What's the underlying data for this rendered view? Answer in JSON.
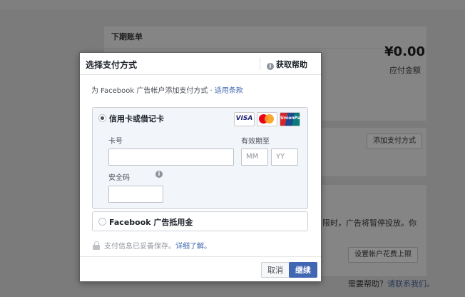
{
  "background": {
    "billing_card_title": "下期账单",
    "amount": "¥0.00",
    "amount_label": "应付金额",
    "add_payment_button": "添加支付方式",
    "warning_text_line1": "限时，广告将暂停投放。你",
    "warning_text_line2": "",
    "set_limit_button": "设置帐户花费上限",
    "help_prefix": "需要帮助？",
    "help_link": "请联系我们。"
  },
  "modal": {
    "title": "选择支付方式",
    "help_label": "获取帮助",
    "intro_text": "为 Facebook 广告帐户添加支付方式 · ",
    "terms_link": "适用条款",
    "option_card": {
      "label": "信用卡或借记卡",
      "selected": true,
      "brands": [
        "VISA",
        "MasterCard",
        "UnionPay"
      ],
      "card_number_label": "卡号",
      "card_number_value": "",
      "expiry_label": "有效期至",
      "month_placeholder": "MM",
      "year_placeholder": "YY",
      "cvv_label": "安全码",
      "cvv_value": ""
    },
    "option_credit": {
      "label": "Facebook 广告抵用金",
      "selected": false
    },
    "secure_text": "支付信息已妥善保存。",
    "learn_more": "详细了解。",
    "cancel_label": "取消",
    "continue_label": "继续"
  },
  "colors": {
    "accent": "#4267b2",
    "overlay": "#7b7b7b"
  },
  "icons": [
    "info-icon",
    "lock-icon",
    "radio-icon",
    "visa-icon",
    "mastercard-icon",
    "unionpay-icon"
  ]
}
